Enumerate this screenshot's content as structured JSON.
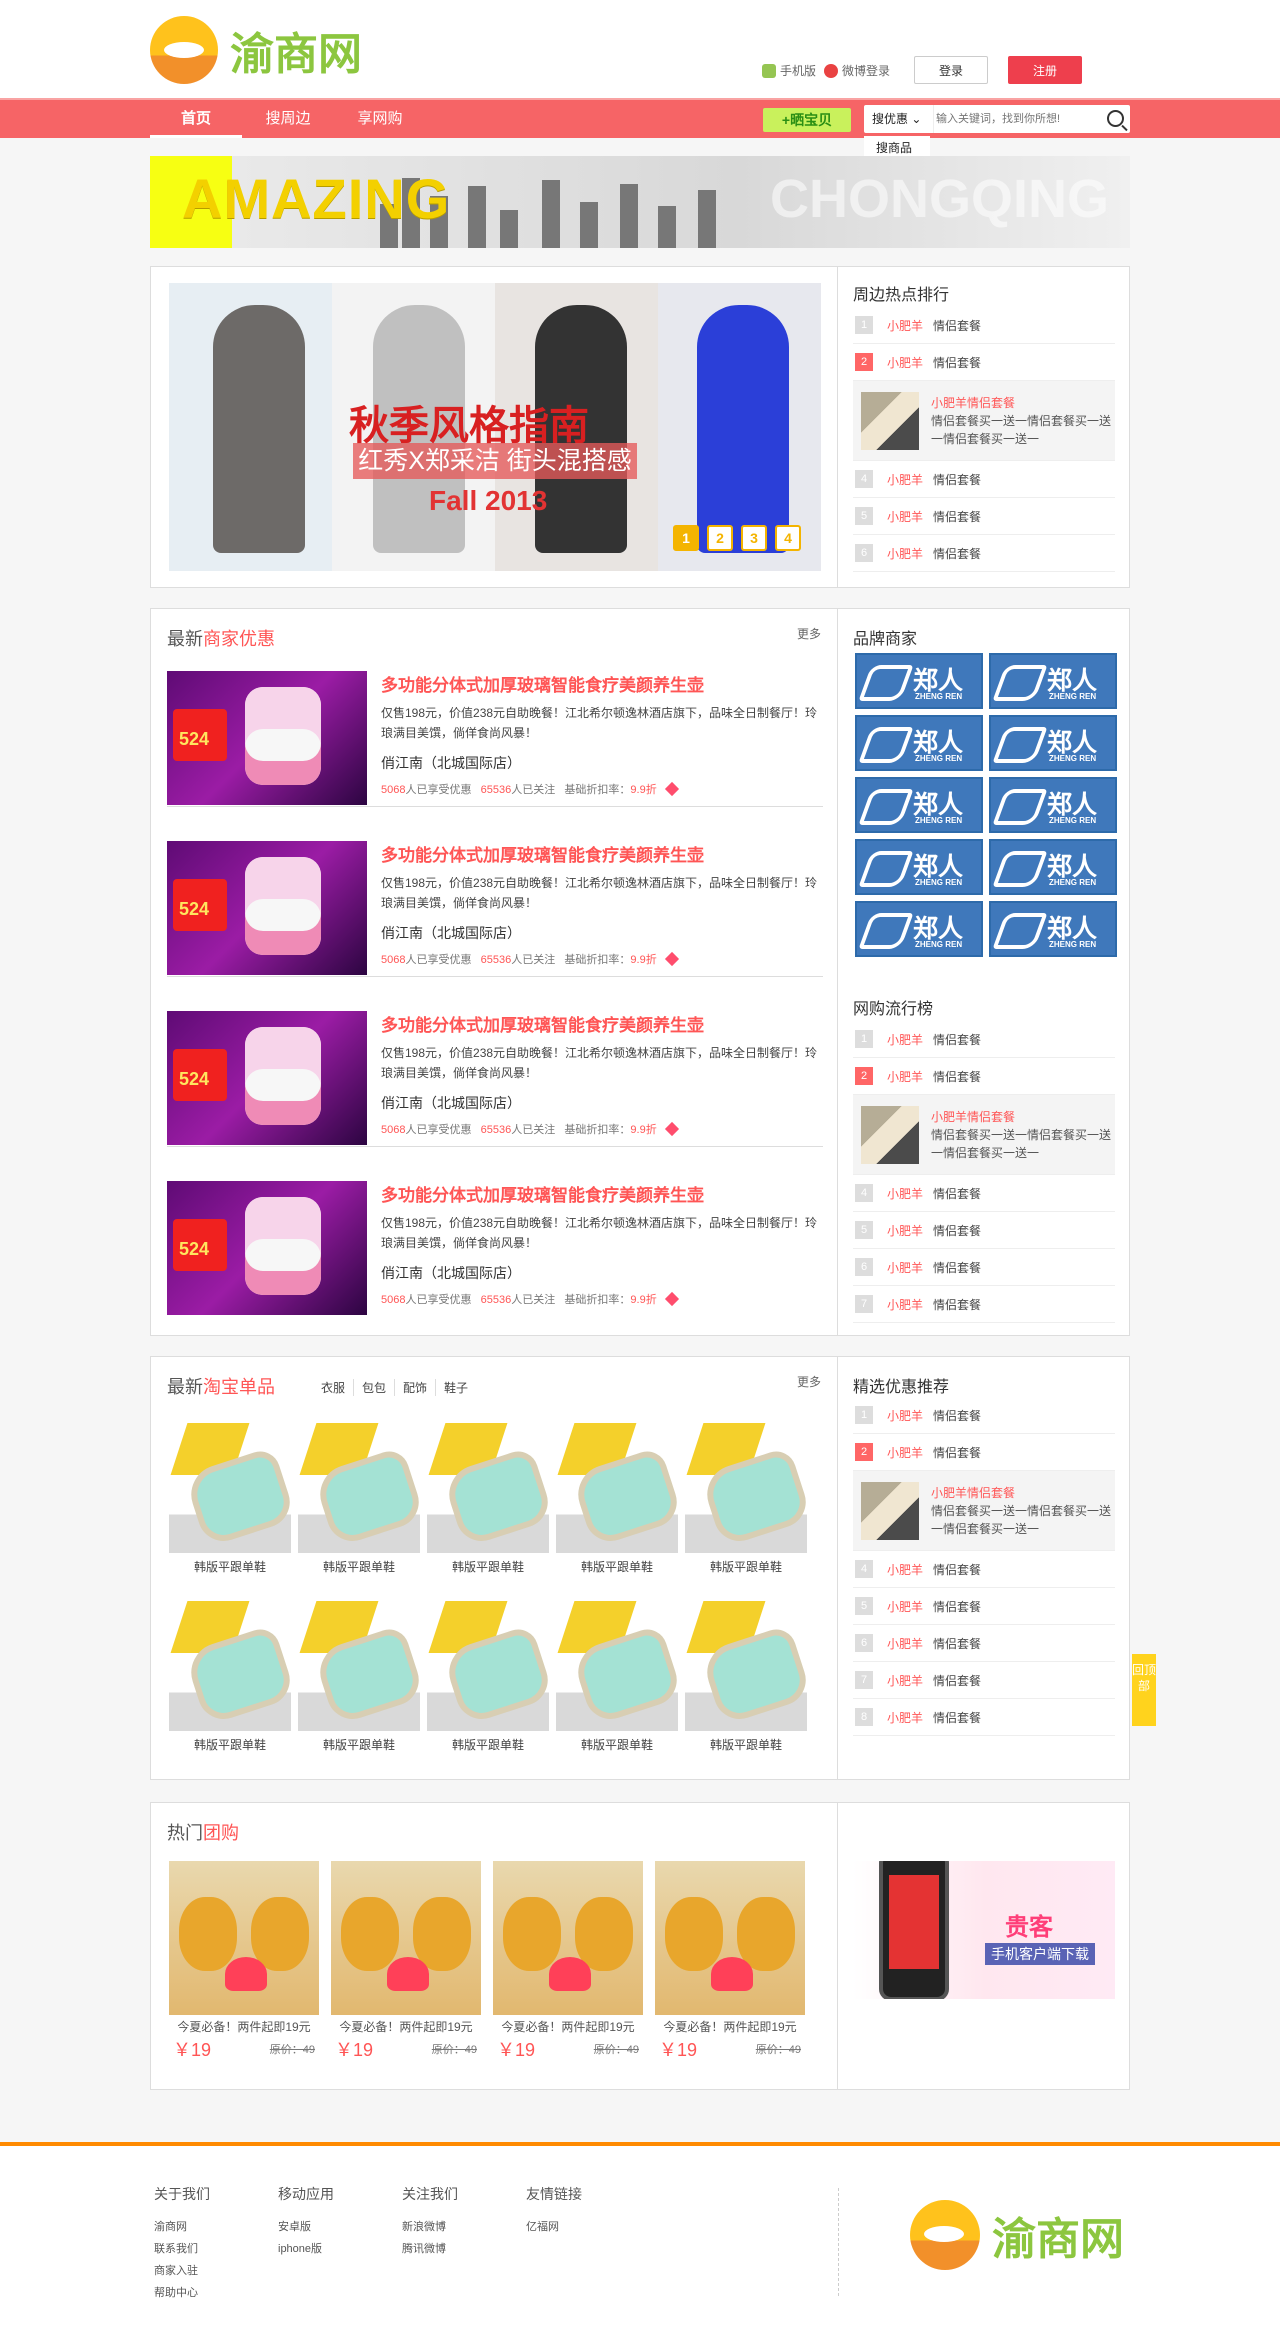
{
  "header": {
    "brand": "渝商网",
    "mobile": "手机版",
    "weibo": "微博登录",
    "login": "登录",
    "register": "注册"
  },
  "nav": {
    "items": [
      "首页",
      "搜周边",
      "享网购"
    ],
    "share": "+晒宝贝",
    "search_type": "搜优惠",
    "search_placeholder": "输入关键词，找到你所想!",
    "dropdown": "搜商品"
  },
  "banner": {
    "left": "AMAZING",
    "right": "CHONGQING"
  },
  "slider": {
    "title": "秋季风格指南",
    "subtitle": "红秀X郑采洁 街头混搭感",
    "year": "Fall 2013",
    "dots": [
      "1",
      "2",
      "3",
      "4"
    ]
  },
  "hot_rank": {
    "title": "周边热点排行",
    "rows": [
      {
        "num": "1",
        "brand": "小肥羊",
        "name": "情侣套餐"
      },
      {
        "num": "2",
        "brand": "小肥羊",
        "name": "情侣套餐"
      },
      {
        "num": "4",
        "brand": "小肥羊",
        "name": "情侣套餐"
      },
      {
        "num": "5",
        "brand": "小肥羊",
        "name": "情侣套餐"
      },
      {
        "num": "6",
        "brand": "小肥羊",
        "name": "情侣套餐"
      }
    ],
    "feature": {
      "title": "小肥羊情侣套餐",
      "desc": "情侣套餐买一送一情侣套餐买一送一情侣套餐买一送一"
    }
  },
  "deals": {
    "title_prefix": "最新",
    "title_highlight": "商家优惠",
    "more": "更多",
    "tag": "524",
    "items": [
      {
        "title": "多功能分体式加厚玻璃智能食疗美颜养生壶",
        "desc": "仅售198元，价值238元自助晚餐！江北希尔顿逸林酒店旗下，品味全日制餐厅！玲琅满目美馔，倘佯食尚风暴！",
        "store": "俏江南（北城国际店）",
        "meta_count": "5068",
        "meta_enjoy": "人已享受优惠",
        "meta_follow_count": "65536",
        "meta_follow": "人已关注",
        "meta_discount": "基础折扣率：",
        "meta_discount_value": "9.9折"
      },
      {
        "title": "多功能分体式加厚玻璃智能食疗美颜养生壶",
        "desc": "仅售198元，价值238元自助晚餐！江北希尔顿逸林酒店旗下，品味全日制餐厅！玲琅满目美馔，倘佯食尚风暴！",
        "store": "俏江南（北城国际店）",
        "meta_count": "5068",
        "meta_enjoy": "人已享受优惠",
        "meta_follow_count": "65536",
        "meta_follow": "人已关注",
        "meta_discount": "基础折扣率：",
        "meta_discount_value": "9.9折"
      },
      {
        "title": "多功能分体式加厚玻璃智能食疗美颜养生壶",
        "desc": "仅售198元，价值238元自助晚餐！江北希尔顿逸林酒店旗下，品味全日制餐厅！玲琅满目美馔，倘佯食尚风暴！",
        "store": "俏江南（北城国际店）",
        "meta_count": "5068",
        "meta_enjoy": "人已享受优惠",
        "meta_follow_count": "65536",
        "meta_follow": "人已关注",
        "meta_discount": "基础折扣率：",
        "meta_discount_value": "9.9折"
      },
      {
        "title": "多功能分体式加厚玻璃智能食疗美颜养生壶",
        "desc": "仅售198元，价值238元自助晚餐！江北希尔顿逸林酒店旗下，品味全日制餐厅！玲琅满目美馔，倘佯食尚风暴！",
        "store": "俏江南（北城国际店）",
        "meta_count": "5068",
        "meta_enjoy": "人已享受优惠",
        "meta_follow_count": "65536",
        "meta_follow": "人已关注",
        "meta_discount": "基础折扣率：",
        "meta_discount_value": "9.9折"
      }
    ]
  },
  "brands": {
    "title": "品牌商家",
    "name": "郑人",
    "en": "ZHENG REN"
  },
  "trend": {
    "title": "网购流行榜",
    "rows": [
      {
        "num": "1",
        "brand": "小肥羊",
        "name": "情侣套餐"
      },
      {
        "num": "2",
        "brand": "小肥羊",
        "name": "情侣套餐"
      },
      {
        "num": "4",
        "brand": "小肥羊",
        "name": "情侣套餐"
      },
      {
        "num": "5",
        "brand": "小肥羊",
        "name": "情侣套餐"
      },
      {
        "num": "6",
        "brand": "小肥羊",
        "name": "情侣套餐"
      },
      {
        "num": "7",
        "brand": "小肥羊",
        "name": "情侣套餐"
      }
    ],
    "feature": {
      "title": "小肥羊情侣套餐",
      "desc": "情侣套餐买一送一情侣套餐买一送一情侣套餐买一送一"
    }
  },
  "products": {
    "title_prefix": "最新",
    "title_highlight": "淘宝单品",
    "more": "更多",
    "tabs": [
      "衣服",
      "包包",
      "配饰",
      "鞋子"
    ],
    "items": [
      "韩版平跟单鞋",
      "韩版平跟单鞋",
      "韩版平跟单鞋",
      "韩版平跟单鞋",
      "韩版平跟单鞋",
      "韩版平跟单鞋",
      "韩版平跟单鞋",
      "韩版平跟单鞋",
      "韩版平跟单鞋",
      "韩版平跟单鞋"
    ]
  },
  "picks": {
    "title": "精选优惠推荐",
    "rows": [
      {
        "num": "1",
        "brand": "小肥羊",
        "name": "情侣套餐"
      },
      {
        "num": "2",
        "brand": "小肥羊",
        "name": "情侣套餐"
      },
      {
        "num": "4",
        "brand": "小肥羊",
        "name": "情侣套餐"
      },
      {
        "num": "5",
        "brand": "小肥羊",
        "name": "情侣套餐"
      },
      {
        "num": "6",
        "brand": "小肥羊",
        "name": "情侣套餐"
      },
      {
        "num": "7",
        "brand": "小肥羊",
        "name": "情侣套餐"
      },
      {
        "num": "8",
        "brand": "小肥羊",
        "name": "情侣套餐"
      }
    ],
    "feature": {
      "title": "小肥羊情侣套餐",
      "desc": "情侣套餐买一送一情侣套餐买一送一情侣套餐买一送一"
    }
  },
  "groupbuy": {
    "title_prefix": "热门",
    "title_highlight": "团购",
    "items": [
      {
        "desc": "今夏必备！两件起即19元",
        "price": "￥19",
        "old": "原价：49"
      },
      {
        "desc": "今夏必备！两件起即19元",
        "price": "￥19",
        "old": "原价：49"
      },
      {
        "desc": "今夏必备！两件起即19元",
        "price": "￥19",
        "old": "原价：49"
      },
      {
        "desc": "今夏必备！两件起即19元",
        "price": "￥19",
        "old": "原价：49"
      }
    ]
  },
  "app": {
    "name": "贵客",
    "subtitle": "手机客户端下载"
  },
  "side_tab": "回顶部",
  "footer": {
    "cols": [
      {
        "head": "关于我们",
        "links": [
          "渝商网",
          "联系我们",
          "商家入驻",
          "帮助中心"
        ]
      },
      {
        "head": "移动应用",
        "links": [
          "安卓版",
          "iphone版"
        ]
      },
      {
        "head": "关注我们",
        "links": [
          "新浪微博",
          "腾讯微博"
        ]
      },
      {
        "head": "友情链接",
        "links": [
          "亿福网"
        ]
      }
    ]
  }
}
